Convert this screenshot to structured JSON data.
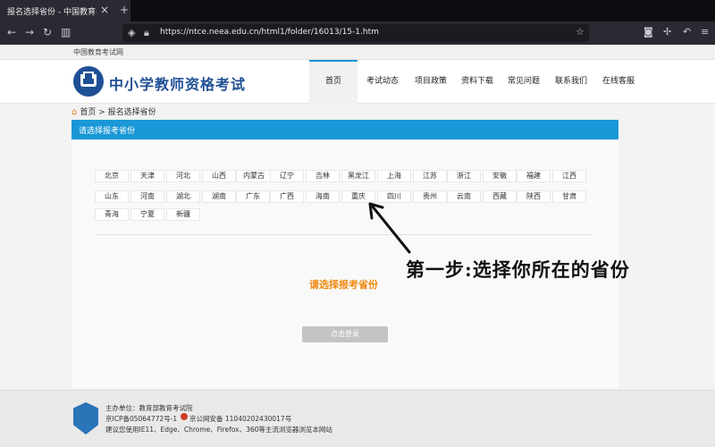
{
  "browser": {
    "tab_title": "报名选择省份 - 中国教育考试网",
    "tab_close": "×",
    "tab_new": "+",
    "url": "https://ntce.neea.edu.cn/html1/folder/16013/15-1.htm"
  },
  "page": {
    "top_strip": "中国教育考试网",
    "site_title": "中小学教师资格考试",
    "nav": [
      "首页",
      "考试动态",
      "项目政策",
      "资料下载",
      "常见问题",
      "联系我们",
      "在线客服"
    ],
    "breadcrumb": "首页 > 报名选择省份",
    "section_bar": "请选择报考省份",
    "provinces": [
      "北京",
      "天津",
      "河北",
      "山西",
      "内蒙古",
      "辽宁",
      "吉林",
      "黑龙江",
      "上海",
      "江苏",
      "浙江",
      "安徽",
      "福建",
      "江西",
      "山东",
      "河南",
      "湖北",
      "湖南",
      "广东",
      "广西",
      "海南",
      "重庆",
      "四川",
      "贵州",
      "云南",
      "西藏",
      "陕西",
      "甘肃",
      "青海",
      "宁夏",
      "新疆"
    ],
    "prompt": "请选择报考省份",
    "next_button": "点击登录",
    "annotation": "第一步:选择你所在的省份"
  },
  "footer": {
    "line1": "主办单位：教育部教育考试院",
    "line2_left": "京ICP备05064772号-1",
    "line2_right": "京公网安备 11040202430017号",
    "line3": "建议您使用IE11、Edge、Chrome、Firefox、360等主流浏览器浏览本网站"
  },
  "colors": {
    "brand_blue": "#1f4f95",
    "bar_blue": "#1a97d7",
    "prompt_orange": "#f08a12"
  }
}
